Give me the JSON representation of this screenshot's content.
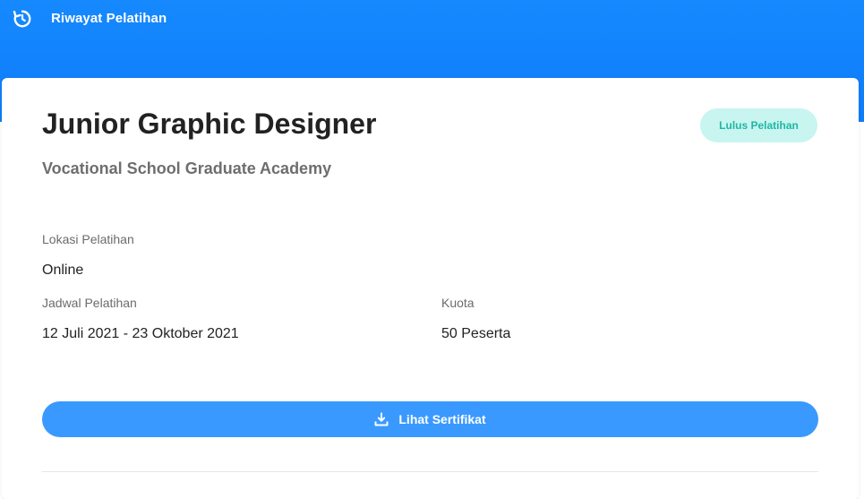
{
  "header": {
    "title": "Riwayat Pelatihan",
    "icon": "history-icon"
  },
  "colors": {
    "header_blue": "#1689ff",
    "button_blue": "#3a99ff",
    "badge_bg": "#c8f5f0",
    "badge_text": "#1fb8a4"
  },
  "course": {
    "title": "Junior Graphic Designer",
    "status": "Lulus Pelatihan",
    "subtitle": "Vocational School Graduate Academy"
  },
  "details": {
    "location_label": "Lokasi Pelatihan",
    "location_value": "Online",
    "schedule_label": "Jadwal Pelatihan",
    "schedule_value": "12 Juli 2021 - 23 Oktober 2021",
    "quota_label": "Kuota",
    "quota_value": "50 Peserta"
  },
  "actions": {
    "certificate_label": "Lihat Sertifikat",
    "certificate_icon": "download-icon"
  }
}
